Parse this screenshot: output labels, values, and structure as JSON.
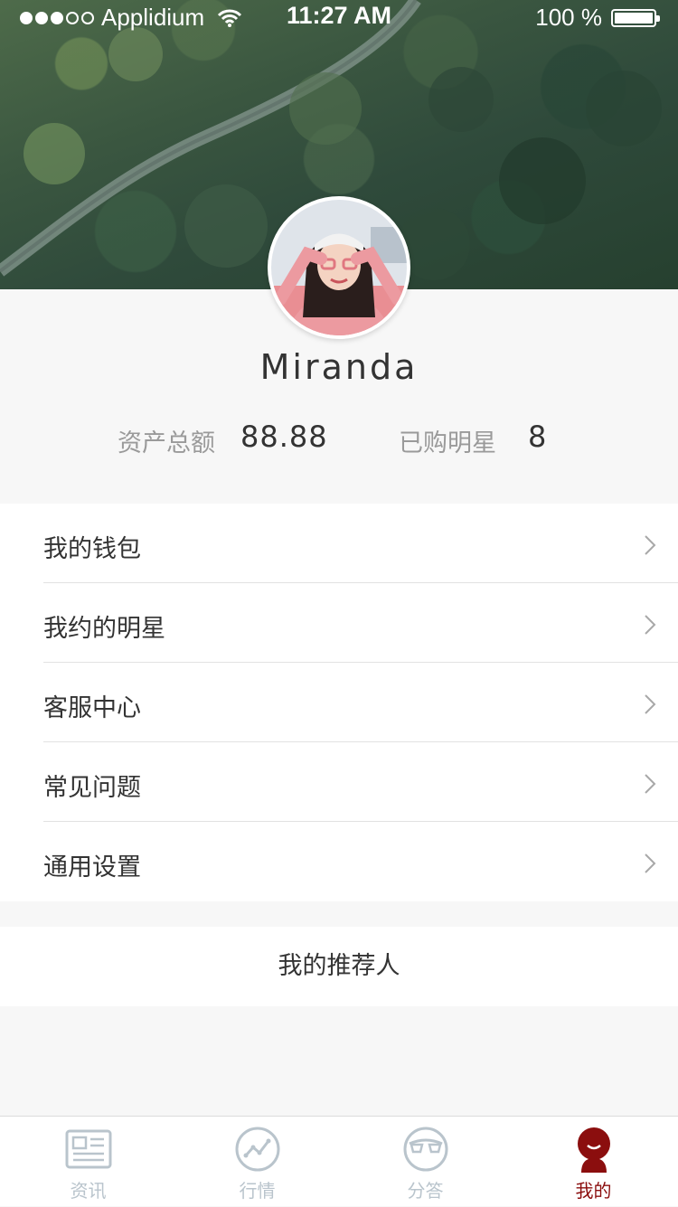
{
  "status_bar": {
    "carrier": "Applidium",
    "time": "11:27 AM",
    "battery": "100 %",
    "signal_bars_filled": 3,
    "signal_bars_total": 5
  },
  "profile": {
    "username": "Miranda",
    "total_assets_label": "资产总额",
    "total_assets_value": "88.88",
    "purchased_stars_label": "已购明星",
    "purchased_stars_value": "8"
  },
  "menu": {
    "items": [
      {
        "label": "我的钱包",
        "icon": "chevron-right-icon"
      },
      {
        "label": "我约的明星",
        "icon": "chevron-right-icon"
      },
      {
        "label": "客服中心",
        "icon": "chevron-right-icon"
      },
      {
        "label": "常见问题",
        "icon": "chevron-right-icon"
      },
      {
        "label": "通用设置",
        "icon": "chevron-right-icon"
      }
    ]
  },
  "referrer": {
    "label": "我的推荐人"
  },
  "tabbar": {
    "tabs": [
      {
        "label": "资讯",
        "icon": "news-icon",
        "active": false
      },
      {
        "label": "行情",
        "icon": "market-trend-icon",
        "active": false
      },
      {
        "label": "分答",
        "icon": "qa-icon",
        "active": false
      },
      {
        "label": "我的",
        "icon": "profile-icon",
        "active": true
      }
    ]
  },
  "colors": {
    "accent": "#8b0e0e",
    "inactive_tab": "#b9c4cc",
    "background": "#f7f7f7"
  }
}
